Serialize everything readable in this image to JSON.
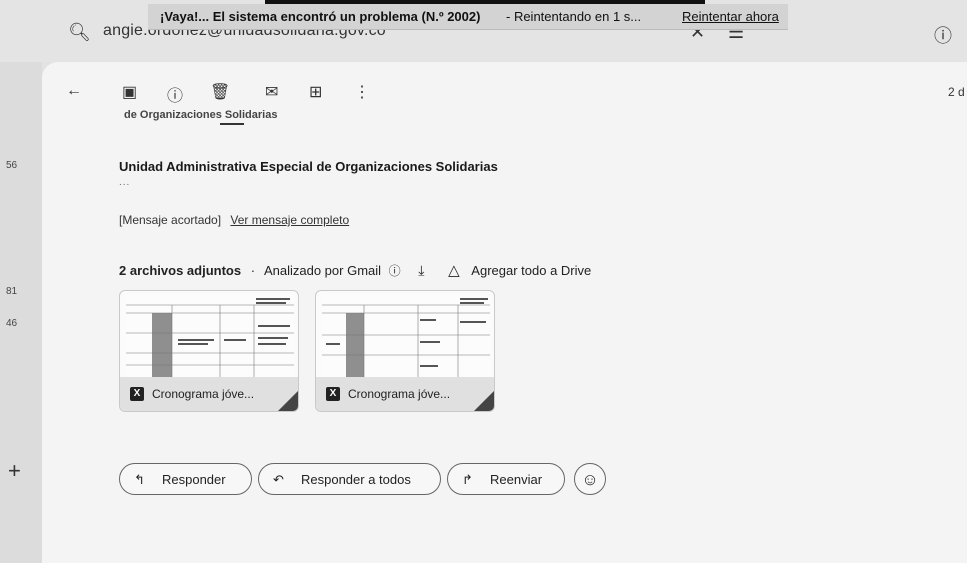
{
  "search": {
    "value": "angie.ordonez@unidadsolidaria.gov.co"
  },
  "error_banner": {
    "message_strong": "¡Vaya!... El sistema encontró un problema (N.º 2002)",
    "message_rest": "- Reintentando en 1 s...",
    "retry_label": "Reintentar ahora"
  },
  "left_rail": {
    "counts": [
      "56",
      "81",
      "46"
    ]
  },
  "toolbar": {
    "date": "2 d"
  },
  "email": {
    "cut_text": "de Organizaciones Solidarias",
    "signature_name": "Unidad Administrativa Especial de Organizaciones Solidarias",
    "dots": "...",
    "trimmed_label": "[Mensaje acortado]",
    "trimmed_link": "Ver mensaje completo"
  },
  "attachments": {
    "count_label": "2 archivos adjuntos",
    "separator": "·",
    "scanned_label": "Analizado por Gmail",
    "drive_label": "Agregar todo a Drive",
    "files": [
      {
        "name": "Cronograma jóve..."
      },
      {
        "name": "Cronograma jóve..."
      }
    ]
  },
  "actions": {
    "reply": "Responder",
    "reply_all": "Responder a todos",
    "forward": "Reenviar"
  },
  "icons": {
    "search": "search-icon",
    "help": "help-icon",
    "back": "arrow-left-icon",
    "archive": "archive-icon",
    "spam": "report-spam-icon",
    "delete": "trash-icon",
    "unread": "mark-unread-icon",
    "move": "move-to-icon",
    "more": "more-vert-icon",
    "download": "download-icon",
    "drive": "drive-add-icon",
    "emoji": "emoji-icon"
  }
}
